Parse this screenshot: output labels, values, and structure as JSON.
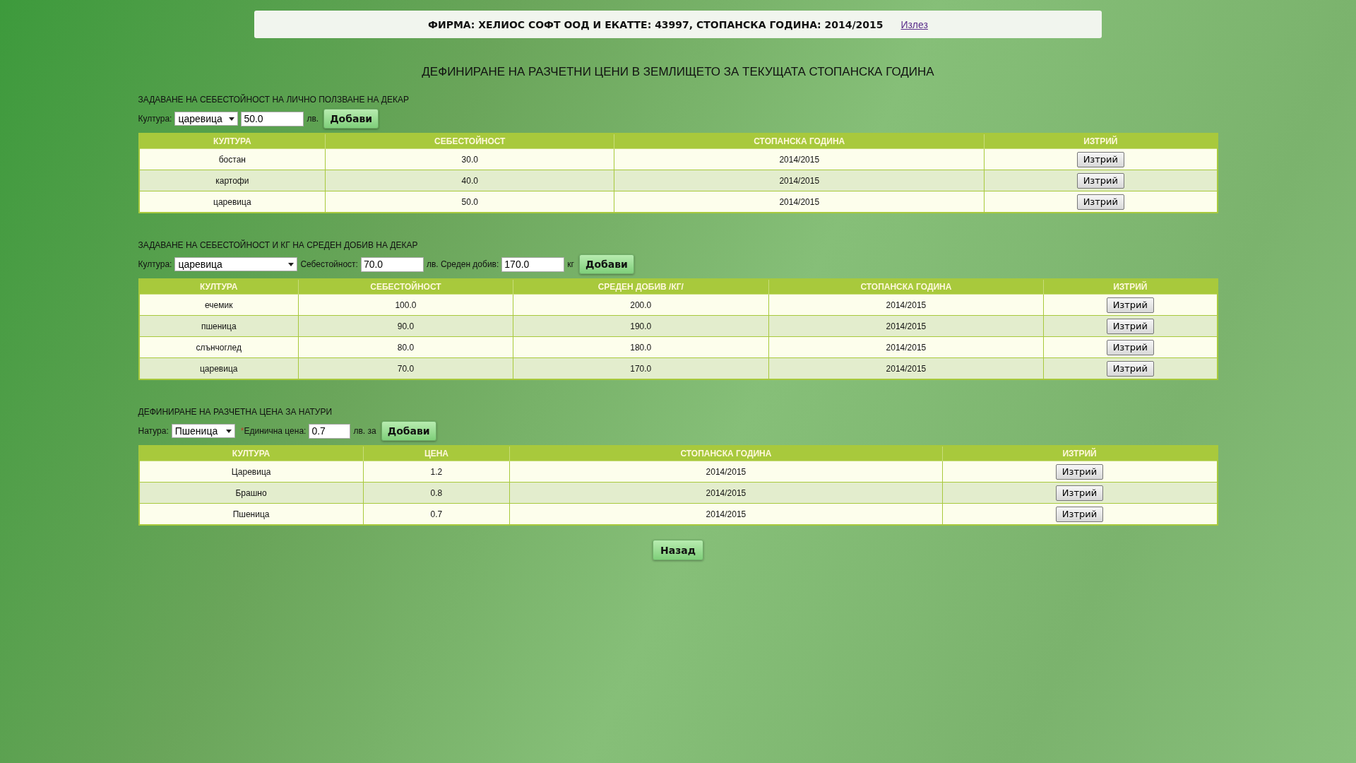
{
  "header": {
    "text": "ФИРМА: ХЕЛИОС СОФТ ООД И ЕКАТТЕ: 43997, СТОПАНСКА ГОДИНА: 2014/2015",
    "logout": "Излез"
  },
  "title": "ДЕФИНИРАНЕ НА РАЗЧЕТНИ ЦЕНИ В ЗЕМЛИЩЕТО ЗА ТЕКУЩАТА СТОПАНСКА ГОДИНА",
  "sections": [
    {
      "heading": "ЗАДАВАНЕ НА СЕБЕСТОЙНОСТ НА ЛИЧНО ПОЛЗВАНЕ НА ДЕКАР",
      "form": [
        {
          "kind": "label",
          "text": "Култура:"
        },
        {
          "kind": "select",
          "value": "царевица"
        },
        {
          "kind": "input",
          "value": "50.0"
        },
        {
          "kind": "label",
          "text": "лв."
        },
        {
          "kind": "button",
          "text": "Добави"
        }
      ],
      "table": {
        "columns": [
          "КУЛТУРА",
          "СЕБЕСТОЙНОСТ",
          "СТОПАНСКА ГОДИНА",
          "ИЗТРИЙ"
        ],
        "rows": [
          {
            "cells": [
              "бостан",
              "30.0",
              "2014/2015"
            ],
            "delete": "Изтрий"
          },
          {
            "cells": [
              "картофи",
              "40.0",
              "2014/2015"
            ],
            "delete": "Изтрий"
          },
          {
            "cells": [
              "царевица",
              "50.0",
              "2014/2015"
            ],
            "delete": "Изтрий"
          }
        ]
      }
    },
    {
      "heading": "ЗАДАВАНЕ НА СЕБЕСТОЙНОСТ И КГ НА СРЕДЕН ДОБИВ НА ДЕКАР",
      "form": [
        {
          "kind": "label",
          "text": "Култура:"
        },
        {
          "kind": "select",
          "value": "царевица"
        },
        {
          "kind": "label",
          "text": "Себестойност:"
        },
        {
          "kind": "input",
          "value": "70.0"
        },
        {
          "kind": "label",
          "text": "лв. Среден добив:"
        },
        {
          "kind": "input",
          "value": "170.0"
        },
        {
          "kind": "label",
          "text": "кг"
        },
        {
          "kind": "button",
          "text": "Добави"
        }
      ],
      "table": {
        "columns": [
          "КУЛТУРА",
          "СЕБЕСТОЙНОСТ",
          "СРЕДЕН ДОБИВ /КГ/",
          "СТОПАНСКА ГОДИНА",
          "ИЗТРИЙ"
        ],
        "rows": [
          {
            "cells": [
              "ечемик",
              "100.0",
              "200.0",
              "2014/2015"
            ],
            "delete": "Изтрий"
          },
          {
            "cells": [
              "пшеница",
              "90.0",
              "190.0",
              "2014/2015"
            ],
            "delete": "Изтрий"
          },
          {
            "cells": [
              "слънчоглед",
              "80.0",
              "180.0",
              "2014/2015"
            ],
            "delete": "Изтрий"
          },
          {
            "cells": [
              "царевица",
              "70.0",
              "170.0",
              "2014/2015"
            ],
            "delete": "Изтрий"
          }
        ]
      }
    },
    {
      "heading": "ДЕФИНИРАНЕ НА РАЗЧЕТНА ЦЕНА ЗА НАТУРИ",
      "form": [
        {
          "kind": "label",
          "text": "Натура:"
        },
        {
          "kind": "select",
          "value": "Пшеница"
        },
        {
          "kind": "label",
          "text": "Единична цена:",
          "required_mark": "*"
        },
        {
          "kind": "input",
          "value": "0.7"
        },
        {
          "kind": "label",
          "text": "лв. за"
        },
        {
          "kind": "button",
          "text": "Добави"
        }
      ],
      "table": {
        "columns": [
          "КУЛТУРА",
          "ЦЕНА",
          "СТОПАНСКА ГОДИНА",
          "ИЗТРИЙ"
        ],
        "rows": [
          {
            "cells": [
              "Царевица",
              "1.2",
              "2014/2015"
            ],
            "delete": "Изтрий"
          },
          {
            "cells": [
              "Брашно",
              "0.8",
              "2014/2015"
            ],
            "delete": "Изтрий"
          },
          {
            "cells": [
              "Пшеница",
              "0.7",
              "2014/2015"
            ],
            "delete": "Изтрий"
          }
        ]
      }
    }
  ],
  "back_button": "Назад"
}
